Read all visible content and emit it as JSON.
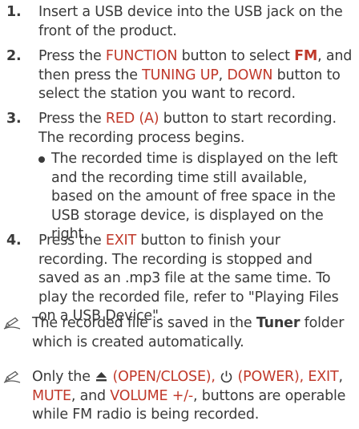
{
  "steps": [
    {
      "num": "1.",
      "line1": "Insert a USB device into the USB jack on the",
      "line2": "front of the product."
    },
    {
      "num": "2.",
      "p1": "Press the ",
      "k1": "FUNCTION",
      "p2": " button to select ",
      "k2": "FM",
      "p3": ", and then press the ",
      "k3": "TUNING UP",
      "p4": ", ",
      "k4": "DOWN",
      "p5": " button to select the station you want to record."
    },
    {
      "num": "3.",
      "p1": "Press the ",
      "k1": "RED (A)",
      "p2": " button to start recording. The recording process begins.",
      "bullet": "The recorded time is displayed on the left and the recording time still available, based on the amount of free space in the USB storage device, is displayed on the right."
    },
    {
      "num": "4.",
      "p1": "Press the ",
      "k1": "EXIT",
      "p2": " button to finish your recording. The recording is stopped and saved as an .mp3 file at the same time. To play the recorded file, refer to \"Playing Files on a USB Device\"."
    }
  ],
  "notes": [
    {
      "icon": "pencil-note-icon",
      "p1": "The recorded file is saved in the ",
      "b1": "Tuner",
      "p2": " folder which is created automatically."
    },
    {
      "icon": "pencil-note-icon",
      "p1": "Only the ",
      "k1": "(OPEN/CLOSE), ",
      "k2": "(POWER), ",
      "k3": "EXIT",
      "p2": ", ",
      "k4": "MUTE",
      "p3": ", and ",
      "k5": "VOLUME +/-",
      "p4": ", buttons are operable while FM radio is being recorded."
    }
  ],
  "colors": {
    "text": "#3a3a3a",
    "keyword": "#c0392b"
  }
}
